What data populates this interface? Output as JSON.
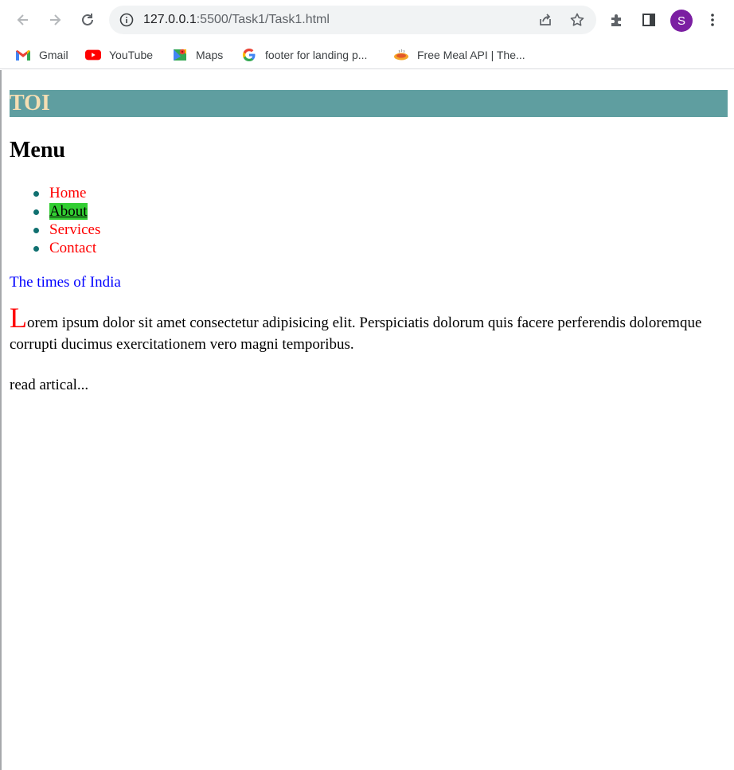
{
  "browser": {
    "url_host": "127.0.0.1",
    "url_path": ":5500/Task1/Task1.html",
    "profile_initial": "S",
    "bookmarks": [
      {
        "label": "Gmail",
        "icon": "gmail-icon"
      },
      {
        "label": "YouTube",
        "icon": "youtube-icon"
      },
      {
        "label": "Maps",
        "icon": "maps-icon"
      },
      {
        "label": "footer for landing p...",
        "icon": "google-icon"
      },
      {
        "label": "Free Meal API | The...",
        "icon": "meal-icon"
      }
    ]
  },
  "page": {
    "title": "TOI",
    "menu_heading": "Menu",
    "menu_items": [
      {
        "label": "Home"
      },
      {
        "label": "About"
      },
      {
        "label": "Services"
      },
      {
        "label": "Contact"
      }
    ],
    "tagline": "The times of India",
    "article_dropcap": "L",
    "article_text": "orem ipsum dolor sit amet consectetur adipisicing elit. Perspiciatis dolorum quis facere perferendis doloremque corrupti ducimus exercitationem vero magni temporibus.",
    "read_more": "read artical..."
  },
  "colors": {
    "title_bg": "#5f9ea0",
    "title_text": "#f5deb3",
    "menu_link": "#ff0000",
    "active_link_bg": "#32cd32",
    "tagline": "#0000ff",
    "avatar_bg": "#7b1fa2"
  }
}
